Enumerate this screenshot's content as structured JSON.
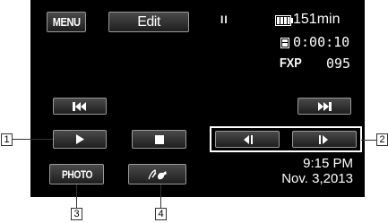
{
  "top_bar": {
    "menu_label": "MENU",
    "edit_label": "Edit",
    "pause_symbol": "II",
    "battery_icon": "battery-icon",
    "battery_time": "151min"
  },
  "status": {
    "card_icon": "memory-card-icon",
    "timecode": "0:00:10",
    "mode_label": "FXP",
    "scene_number": "095"
  },
  "controls": {
    "skip_back_icon": "skip-to-start-icon",
    "skip_forward_icon": "skip-to-end-icon",
    "play_icon": "play-icon",
    "stop_icon": "stop-icon",
    "frame_back_icon": "frame-back-icon",
    "frame_forward_icon": "frame-forward-icon"
  },
  "bottom_bar": {
    "photo_label": "PHOTO",
    "decoration_icon": "decoration-pen-icon",
    "time": "9:15 PM",
    "date": "Nov. 3,2013"
  },
  "callouts": {
    "c1": "1",
    "c2": "2",
    "c3": "3",
    "c4": "4"
  },
  "colors": {
    "screen_background": "#000000",
    "button_border": "#9a9a9a",
    "text": "#ffffff"
  }
}
